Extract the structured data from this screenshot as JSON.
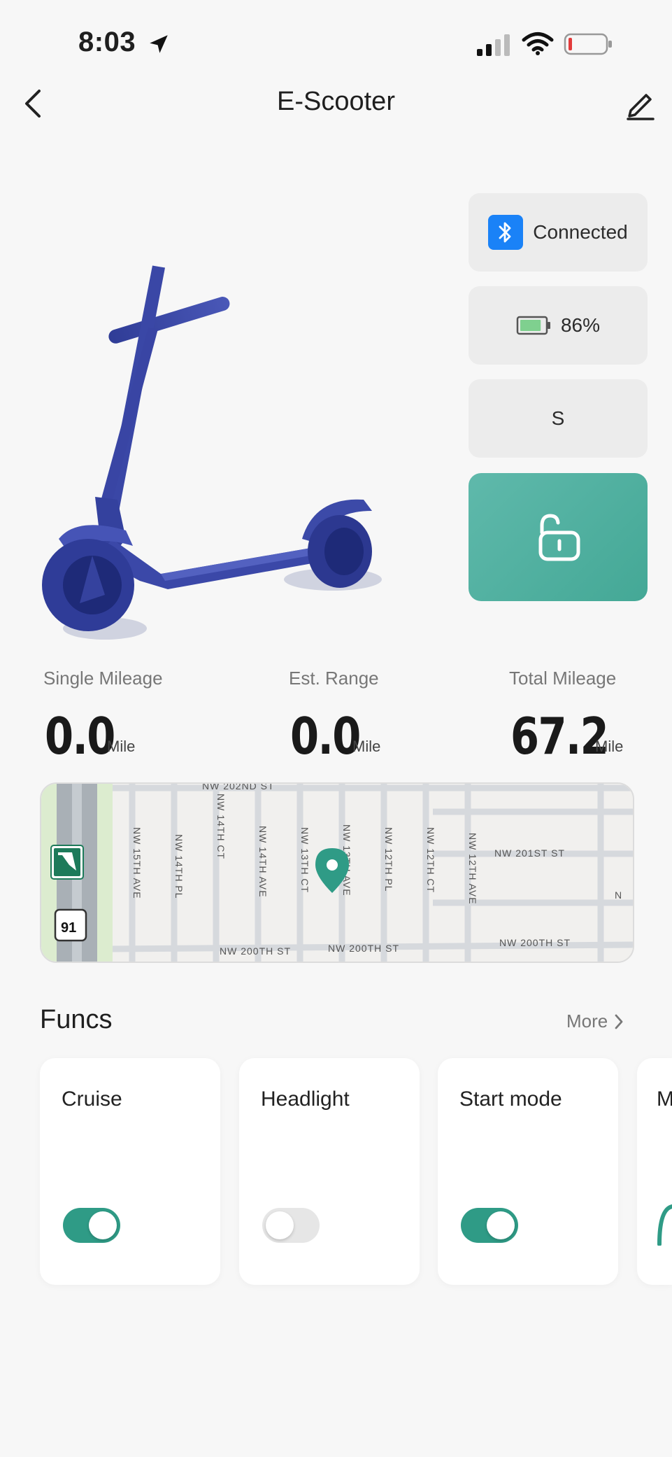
{
  "status_bar": {
    "time": "8:03"
  },
  "nav": {
    "title": "E-Scooter"
  },
  "device": {
    "connection_label": "Connected",
    "battery_label": "86%",
    "battery_level": 0.86,
    "gear_label": "S",
    "lock_state": "unlocked"
  },
  "stats": [
    {
      "label": "Single Mileage",
      "value": "0.0",
      "unit": "Mile"
    },
    {
      "label": "Est. Range",
      "value": "0.0",
      "unit": "Mile"
    },
    {
      "label": "Total Mileage",
      "value": "67.2",
      "unit": "Mile"
    }
  ],
  "map": {
    "streets_h": [
      "NW 202ND ST",
      "NW 201ST ST",
      "NW 200TH ST",
      "NW 200TH ST",
      "NW 200TH ST"
    ],
    "streets_v": [
      "NW 15TH AVE",
      "NW 14TH PL",
      "NW 14TH CT",
      "NW 14TH AVE",
      "NW 13TH CT",
      "NW 13TH AVE",
      "NW 12TH PL",
      "NW 12TH CT",
      "NW 12TH AVE"
    ],
    "shield_route": "91",
    "edge_letter": "N"
  },
  "funcs": {
    "title": "Funcs",
    "more_label": "More",
    "items": [
      {
        "label": "Cruise",
        "on": true
      },
      {
        "label": "Headlight",
        "on": false
      },
      {
        "label": "Start mode",
        "on": true
      },
      {
        "label": "M",
        "on": true
      }
    ]
  },
  "colors": {
    "accent": "#2f9b86",
    "lock_card": "#4eae9e",
    "bluetooth": "#1a82f7",
    "battery_fill": "#7fd08f",
    "battery_low": "#e23b3b",
    "scooter": "#3c4aa8"
  }
}
